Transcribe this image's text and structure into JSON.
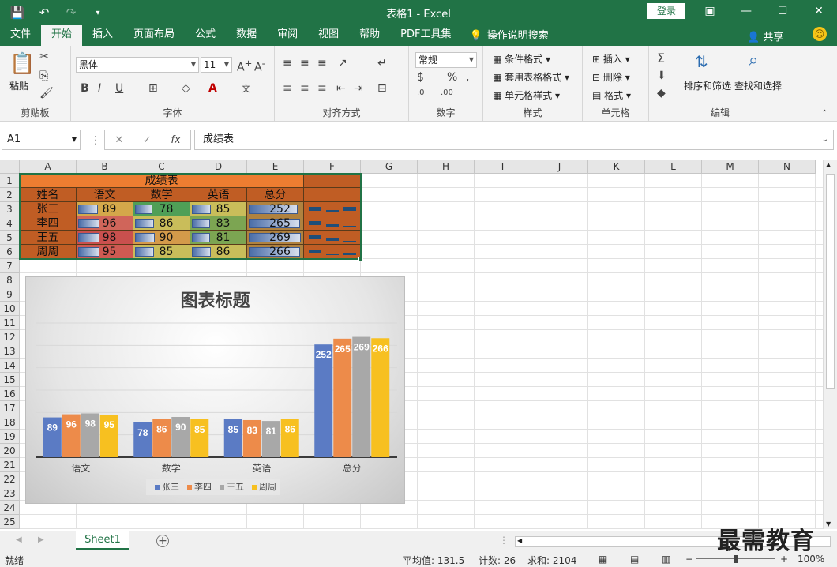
{
  "window": {
    "title": "表格1 - Excel",
    "login": "登录",
    "controls": [
      "restore-icon",
      "minimize-icon",
      "maximize-icon",
      "close-icon"
    ]
  },
  "tabs": [
    {
      "label": "文件"
    },
    {
      "label": "开始",
      "active": true
    },
    {
      "label": "插入"
    },
    {
      "label": "页面布局"
    },
    {
      "label": "公式"
    },
    {
      "label": "数据"
    },
    {
      "label": "审阅"
    },
    {
      "label": "视图"
    },
    {
      "label": "帮助"
    },
    {
      "label": "PDF工具集"
    }
  ],
  "tell_me": "操作说明搜索",
  "share": "共享",
  "ribbon": {
    "clipboard": {
      "label": "剪贴板",
      "paste": "粘贴"
    },
    "font": {
      "label": "字体",
      "name": "黑体",
      "size": "11"
    },
    "alignment": {
      "label": "对齐方式"
    },
    "number": {
      "label": "数字",
      "format": "常规"
    },
    "styles": {
      "label": "样式",
      "conditional": "条件格式",
      "as_table": "套用表格格式",
      "cell_styles": "单元格样式"
    },
    "cells": {
      "label": "单元格",
      "insert": "插入",
      "delete": "删除",
      "format": "格式"
    },
    "editing": {
      "label": "编辑",
      "sort": "排序和筛选",
      "find": "查找和选择"
    }
  },
  "formula_bar": {
    "name_box": "A1",
    "value": "成绩表"
  },
  "columns": [
    "A",
    "B",
    "C",
    "D",
    "E",
    "F",
    "G",
    "H",
    "I",
    "J",
    "K",
    "L",
    "M",
    "N"
  ],
  "rows": [
    "1",
    "2",
    "3",
    "4",
    "5",
    "6",
    "7",
    "8",
    "9",
    "10",
    "11",
    "12",
    "13",
    "14",
    "15",
    "16",
    "17",
    "18",
    "19",
    "20",
    "21",
    "22",
    "23",
    "24",
    "25"
  ],
  "table": {
    "title": "成绩表",
    "headers": [
      "姓名",
      "语文",
      "数学",
      "英语",
      "总分"
    ],
    "data": [
      {
        "name": "张三",
        "scores": [
          89,
          78,
          85
        ],
        "total": 252,
        "spark": [
          1,
          0.5,
          0.95
        ]
      },
      {
        "name": "李四",
        "scores": [
          96,
          86,
          83
        ],
        "total": 265,
        "spark": [
          1,
          0.5,
          0.3
        ]
      },
      {
        "name": "王五",
        "scores": [
          98,
          90,
          81
        ],
        "total": 269,
        "spark": [
          1,
          0.5,
          0.1
        ]
      },
      {
        "name": "周周",
        "scores": [
          95,
          85,
          86
        ],
        "total": 266,
        "spark": [
          1,
          0.3,
          0.5
        ]
      }
    ],
    "colors": {
      "title_bg": "#ed7d31",
      "header_bg": "#c05d24",
      "name_bg": "#c05d24",
      "total_bg": "#b0823f"
    },
    "score_colors": [
      [
        "#d4a84a",
        "#4f9f57",
        "#c9bd5a"
      ],
      [
        "#d0655a",
        "#c9bd5a",
        "#7ca552"
      ],
      [
        "#c9504e",
        "#d49a4a",
        "#7ca552"
      ],
      [
        "#cf5a52",
        "#c9bd5a",
        "#c9bd5a"
      ]
    ]
  },
  "chart_data": {
    "type": "bar",
    "title": "图表标题",
    "categories": [
      "语文",
      "数学",
      "英语",
      "总分"
    ],
    "series": [
      {
        "name": "张三",
        "color": "#5b7bc4",
        "values": [
          89,
          78,
          85,
          252
        ]
      },
      {
        "name": "李四",
        "color": "#ed8b4a",
        "values": [
          96,
          86,
          83,
          265
        ]
      },
      {
        "name": "王五",
        "color": "#a8a8a8",
        "values": [
          98,
          90,
          81,
          269
        ]
      },
      {
        "name": "周周",
        "color": "#f7c020",
        "values": [
          95,
          85,
          86,
          266
        ]
      }
    ],
    "ylim": [
      0,
      300
    ],
    "grid": true,
    "legend": "bottom"
  },
  "sheets": [
    {
      "label": "Sheet1",
      "active": true
    }
  ],
  "status": {
    "mode": "就绪",
    "average": "平均值: 131.5",
    "count": "计数: 26",
    "sum": "求和: 2104",
    "zoom": "100%"
  },
  "watermark": "最需教育"
}
